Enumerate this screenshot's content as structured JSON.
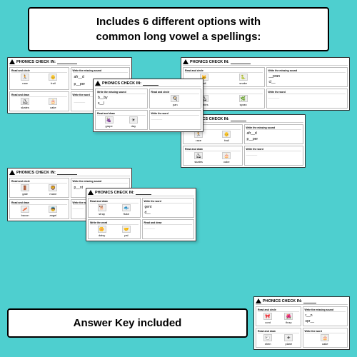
{
  "title": {
    "line1": "Includes 6 different options with",
    "line2": "common long vowel a spellings:"
  },
  "worksheets": [
    {
      "id": "ws1",
      "header": "PHONICS CHECK IN:",
      "sections": [
        {
          "label": "Read and circle",
          "words": [
            "race",
            "frail"
          ]
        },
        {
          "label": "Write the missing sound",
          "blanks": [
            "afr__d",
            "p__per"
          ]
        },
        {
          "label": "Read and draw",
          "words": [
            "skates",
            "cake"
          ]
        },
        {
          "label": "Write the word",
          "blanks": []
        }
      ]
    },
    {
      "id": "ws2",
      "header": "PHONICS CHECK IN:",
      "sections": [
        {
          "label": "Read and circle",
          "words": [
            "tail",
            "snake"
          ]
        },
        {
          "label": "Write the missing sound",
          "blanks": [
            "__pran",
            "cl__"
          ]
        },
        {
          "label": "Read and draw",
          "words": [
            "skates",
            "spran"
          ]
        },
        {
          "label": "Write the word",
          "blanks": []
        }
      ]
    },
    {
      "id": "ws3",
      "header": "PHONICS CHECK IN:",
      "sections": [
        {
          "label": "Read and circle",
          "words": []
        },
        {
          "label": "Write the missing sound",
          "blanks": [
            "b__by",
            "s__l"
          ]
        },
        {
          "label": "Read and draw",
          "words": [
            "grape",
            "day"
          ]
        },
        {
          "label": "Write the word",
          "blanks": []
        }
      ]
    },
    {
      "id": "ws4",
      "header": "PHONICS CHECK IN:",
      "sections": [
        {
          "label": "Read and circle",
          "words": [
            "gate",
            "mane"
          ]
        },
        {
          "label": "Write the missing sound",
          "blanks": [
            "p__nt"
          ]
        },
        {
          "label": "Read and draw",
          "words": [
            "bacon",
            "angel"
          ]
        },
        {
          "label": "Write the word",
          "blanks": []
        }
      ]
    },
    {
      "id": "ws5",
      "header": "PHONICS CHECK IN:",
      "sections": [
        {
          "label": "Read and circle",
          "words": [
            "race",
            "frail"
          ]
        },
        {
          "label": "Write the missing sound",
          "blanks": [
            "afr__d",
            "p__per"
          ]
        },
        {
          "label": "Read and draw",
          "words": [
            "skates",
            "cake"
          ]
        },
        {
          "label": "Write the word",
          "blanks": []
        }
      ]
    },
    {
      "id": "ws6",
      "header": "PHONICS CHECK IN:",
      "sections": [
        {
          "label": "Read and draw",
          "words": [
            "stray",
            "fluke",
            "gent",
            "d__"
          ]
        },
        {
          "label": "Write the word",
          "words": [
            "daisy",
            "pal"
          ]
        }
      ]
    },
    {
      "id": "ws7",
      "header": "PHONICS CHECK IN:",
      "sections": [
        {
          "label": "Read and circle",
          "words": [
            "cord",
            "finzy"
          ]
        },
        {
          "label": "Write the missing sound",
          "blanks": [
            "r__n",
            "spr__"
          ]
        },
        {
          "label": "Read and draw",
          "words": [
            "shen",
            "plane"
          ]
        },
        {
          "label": "Write the word",
          "words": [
            "cake"
          ]
        }
      ]
    }
  ],
  "answer_key": {
    "text": "Answer Key included"
  },
  "icons": {
    "race_icon": "🏃",
    "frail_icon": "👴",
    "tail_icon": "🐱",
    "snake_icon": "🐍",
    "skates_icon": "⛸",
    "cake_icon": "🎂",
    "grape_icon": "🍇",
    "bacon_icon": "🥓",
    "angel_icon": "👼",
    "stray_icon": "🐕",
    "fluke_icon": "🐳",
    "daisy_icon": "🌼",
    "plane_icon": "✈"
  }
}
